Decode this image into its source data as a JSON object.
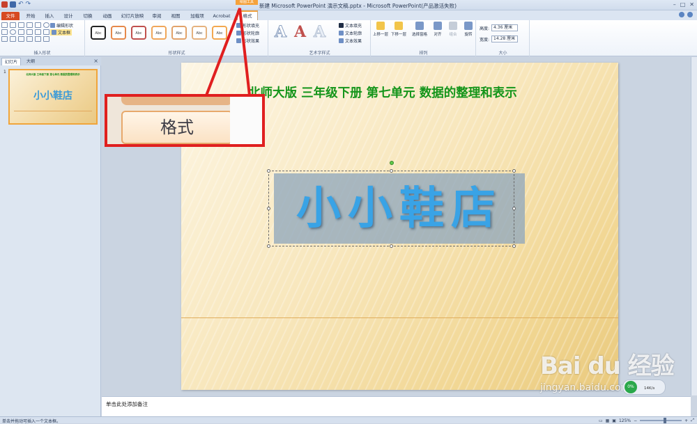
{
  "window": {
    "title": "新建 Microsoft PowerPoint 演示文稿.pptx - Microsoft PowerPoint(产品激活失败)",
    "context_label": "绘图工具"
  },
  "tabs": {
    "file": "文件",
    "home": "开始",
    "insert": "插入",
    "design": "设计",
    "transitions": "切换",
    "animations": "动画",
    "slideshow": "幻灯片放映",
    "review": "审阅",
    "view": "视图",
    "addins": "加载项",
    "acrobat": "Acrobat",
    "format": "格式"
  },
  "ribbon": {
    "insert_shapes": {
      "label": "插入形状",
      "edit_shape": "编辑形状",
      "text_box": "文本框"
    },
    "shape_styles": {
      "label": "形状样式",
      "swatch_text": "Abc",
      "swatch_colors": [
        "#222222",
        "#e5884a",
        "#c0504d",
        "#f0a65a",
        "#e2a36a",
        "#e5b27e",
        "#f3a850"
      ],
      "fill": "形状填充",
      "outline": "形状轮廓",
      "effects": "形状效果"
    },
    "wordart": {
      "label": "艺术字样式",
      "letter": "A",
      "text_fill": "文本填充",
      "text_outline": "文本轮廓",
      "text_effects": "文本效果"
    },
    "arrange": {
      "label": "排列",
      "bring_forward": "上移一层",
      "send_backward": "下移一层",
      "selection_pane": "选择窗格",
      "align": "对齐",
      "group": "组合",
      "rotate": "旋转"
    },
    "size": {
      "label": "大小",
      "height_label": "高度:",
      "height_value": "4.36 厘米",
      "width_label": "宽度:",
      "width_value": "14.28 厘米"
    }
  },
  "left_pane": {
    "tab_slides": "幻灯片",
    "tab_outline": "大纲",
    "close": "×",
    "slide_number": "1"
  },
  "slide": {
    "subtitle": "北师大版 三年级下册 第七单元 数据的整理和表示",
    "title": "小小鞋店"
  },
  "callout": {
    "label": "格式"
  },
  "notes": {
    "placeholder": "单击此处添加备注"
  },
  "statusbar": {
    "hint": "单击并拖动可插入一个文本框。",
    "zoom": "125%"
  },
  "watermark": {
    "logo": "Bai du 经验",
    "url": "jingyan.baidu.com"
  },
  "speed_widget": {
    "percent": "0%",
    "rate": "14K/s"
  }
}
